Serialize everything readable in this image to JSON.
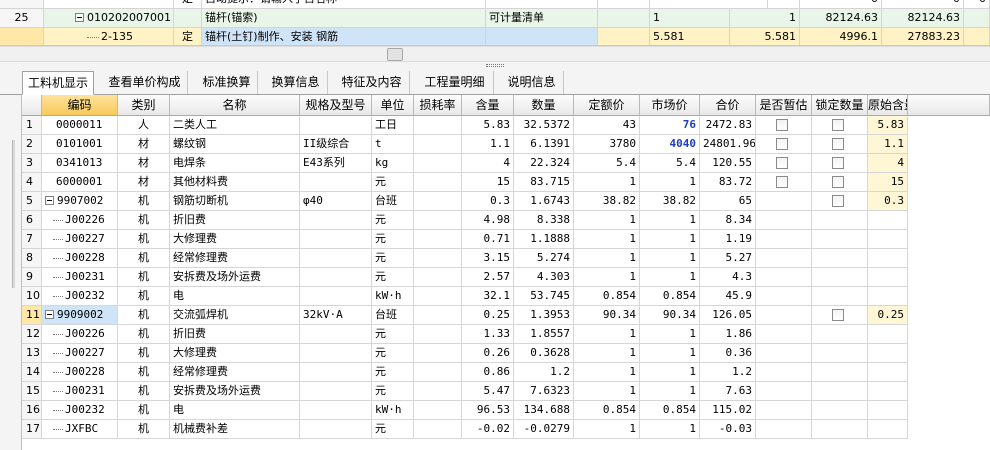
{
  "top_grid": {
    "rows": [
      {
        "num": "",
        "code": "",
        "type": "定",
        "name": "自动提示：请输入子目名称",
        "unit": "",
        "expr": "",
        "qty": "",
        "col8": "0",
        "col9": "0",
        "col10": "0"
      },
      {
        "num": "25",
        "code": "010202007001",
        "type": "",
        "name": "锚杆(锚索)",
        "unit": "可计量清单",
        "expr": "1",
        "qty": "1",
        "col8": "82124.63",
        "col9": "82124.63",
        "col10": ""
      },
      {
        "num": "",
        "code": "2-135",
        "type": "定",
        "name": "锚杆(土钉)制作、安装 钢筋",
        "unit": "",
        "expr": "5.581",
        "qty": "5.581",
        "col8": "4996.1",
        "col9": "27883.23",
        "col10": ""
      }
    ]
  },
  "tabs": [
    {
      "label": "工料机显示",
      "active": true
    },
    {
      "label": "查看单价构成",
      "active": false
    },
    {
      "label": "标准换算",
      "active": false
    },
    {
      "label": "换算信息",
      "active": false
    },
    {
      "label": "特征及内容",
      "active": false
    },
    {
      "label": "工程量明细",
      "active": false
    },
    {
      "label": "说明信息",
      "active": false
    }
  ],
  "main_grid": {
    "headers": [
      "编码",
      "类别",
      "名称",
      "规格及型号",
      "单位",
      "损耗率",
      "含量",
      "数量",
      "定额价",
      "市场价",
      "合价",
      "是否暂估",
      "锁定数量",
      "原始含量"
    ],
    "rows": [
      {
        "n": "1",
        "code": "0000011",
        "cat": "人",
        "name": "二类人工",
        "spec": "",
        "unit": "工日",
        "loss": "",
        "content": "5.83",
        "qty": "32.5372",
        "quota": "43",
        "market": "76",
        "total": "2472.83",
        "est": false,
        "lock": true,
        "orig": "5.83",
        "market_hi": true,
        "child": false,
        "group": false
      },
      {
        "n": "2",
        "code": "0101001",
        "cat": "材",
        "name": "螺纹钢",
        "spec": "II级综合",
        "unit": "t",
        "loss": "",
        "content": "1.1",
        "qty": "6.1391",
        "quota": "3780",
        "market": "4040",
        "total": "24801.96",
        "est": true,
        "lock": true,
        "orig": "1.1",
        "market_hi": true,
        "child": false,
        "group": false
      },
      {
        "n": "3",
        "code": "0341013",
        "cat": "材",
        "name": "电焊条",
        "spec": "E43系列",
        "unit": "kg",
        "loss": "",
        "content": "4",
        "qty": "22.324",
        "quota": "5.4",
        "market": "5.4",
        "total": "120.55",
        "est": true,
        "lock": true,
        "orig": "4",
        "market_hi": false,
        "child": false,
        "group": false
      },
      {
        "n": "4",
        "code": "6000001",
        "cat": "材",
        "name": "其他材料费",
        "spec": "",
        "unit": "元",
        "loss": "",
        "content": "15",
        "qty": "83.715",
        "quota": "1",
        "market": "1",
        "total": "83.72",
        "est": false,
        "lock": true,
        "orig": "15",
        "market_hi": false,
        "child": false,
        "group": false
      },
      {
        "n": "5",
        "code": "9907002",
        "cat": "机",
        "name": "钢筋切断机",
        "spec": "φ40",
        "unit": "台班",
        "loss": "",
        "content": "0.3",
        "qty": "1.6743",
        "quota": "38.82",
        "market": "38.82",
        "total": "65",
        "est": null,
        "lock": true,
        "orig": "0.3",
        "market_hi": false,
        "child": false,
        "group": true
      },
      {
        "n": "6",
        "code": "J00226",
        "cat": "机",
        "name": "折旧费",
        "spec": "",
        "unit": "元",
        "loss": "",
        "content": "4.98",
        "qty": "8.338",
        "quota": "1",
        "market": "1",
        "total": "8.34",
        "est": null,
        "lock": null,
        "orig": "",
        "market_hi": false,
        "child": true,
        "group": false
      },
      {
        "n": "7",
        "code": "J00227",
        "cat": "机",
        "name": "大修理费",
        "spec": "",
        "unit": "元",
        "loss": "",
        "content": "0.71",
        "qty": "1.1888",
        "quota": "1",
        "market": "1",
        "total": "1.19",
        "est": null,
        "lock": null,
        "orig": "",
        "market_hi": false,
        "child": true,
        "group": false
      },
      {
        "n": "8",
        "code": "J00228",
        "cat": "机",
        "name": "经常修理费",
        "spec": "",
        "unit": "元",
        "loss": "",
        "content": "3.15",
        "qty": "5.274",
        "quota": "1",
        "market": "1",
        "total": "5.27",
        "est": null,
        "lock": null,
        "orig": "",
        "market_hi": false,
        "child": true,
        "group": false
      },
      {
        "n": "9",
        "code": "J00231",
        "cat": "机",
        "name": "安拆费及场外运费",
        "spec": "",
        "unit": "元",
        "loss": "",
        "content": "2.57",
        "qty": "4.303",
        "quota": "1",
        "market": "1",
        "total": "4.3",
        "est": null,
        "lock": null,
        "orig": "",
        "market_hi": false,
        "child": true,
        "group": false
      },
      {
        "n": "10",
        "code": "J00232",
        "cat": "机",
        "name": "电",
        "spec": "",
        "unit": "kW·h",
        "loss": "",
        "content": "32.1",
        "qty": "53.745",
        "quota": "0.854",
        "market": "0.854",
        "total": "45.9",
        "est": null,
        "lock": null,
        "orig": "",
        "market_hi": false,
        "child": true,
        "group": false
      },
      {
        "n": "11",
        "code": "9909002",
        "cat": "机",
        "name": "交流弧焊机",
        "spec": "32kV·A",
        "unit": "台班",
        "loss": "",
        "content": "0.25",
        "qty": "1.3953",
        "quota": "90.34",
        "market": "90.34",
        "total": "126.05",
        "est": null,
        "lock": true,
        "orig": "0.25",
        "market_hi": false,
        "child": false,
        "group": true
      },
      {
        "n": "12",
        "code": "J00226",
        "cat": "机",
        "name": "折旧费",
        "spec": "",
        "unit": "元",
        "loss": "",
        "content": "1.33",
        "qty": "1.8557",
        "quota": "1",
        "market": "1",
        "total": "1.86",
        "est": null,
        "lock": null,
        "orig": "",
        "market_hi": false,
        "child": true,
        "group": false
      },
      {
        "n": "13",
        "code": "J00227",
        "cat": "机",
        "name": "大修理费",
        "spec": "",
        "unit": "元",
        "loss": "",
        "content": "0.26",
        "qty": "0.3628",
        "quota": "1",
        "market": "1",
        "total": "0.36",
        "est": null,
        "lock": null,
        "orig": "",
        "market_hi": false,
        "child": true,
        "group": false
      },
      {
        "n": "14",
        "code": "J00228",
        "cat": "机",
        "name": "经常修理费",
        "spec": "",
        "unit": "元",
        "loss": "",
        "content": "0.86",
        "qty": "1.2",
        "quota": "1",
        "market": "1",
        "total": "1.2",
        "est": null,
        "lock": null,
        "orig": "",
        "market_hi": false,
        "child": true,
        "group": false
      },
      {
        "n": "15",
        "code": "J00231",
        "cat": "机",
        "name": "安拆费及场外运费",
        "spec": "",
        "unit": "元",
        "loss": "",
        "content": "5.47",
        "qty": "7.6323",
        "quota": "1",
        "market": "1",
        "total": "7.63",
        "est": null,
        "lock": null,
        "orig": "",
        "market_hi": false,
        "child": true,
        "group": false
      },
      {
        "n": "16",
        "code": "J00232",
        "cat": "机",
        "name": "电",
        "spec": "",
        "unit": "kW·h",
        "loss": "",
        "content": "96.53",
        "qty": "134.688",
        "quota": "0.854",
        "market": "0.854",
        "total": "115.02",
        "est": null,
        "lock": null,
        "orig": "",
        "market_hi": false,
        "child": true,
        "group": false
      },
      {
        "n": "17",
        "code": "JXFBC",
        "cat": "机",
        "name": "机械费补差",
        "spec": "",
        "unit": "元",
        "loss": "",
        "content": "-0.02",
        "qty": "-0.0279",
        "quota": "1",
        "market": "1",
        "total": "-0.03",
        "est": null,
        "lock": null,
        "orig": "",
        "market_hi": false,
        "child": true,
        "group": false
      }
    ]
  },
  "colors": {
    "selected_header": "#f7c95a",
    "highlight_row": "#e9f5e9",
    "blue_value": "#1f3fb9",
    "current_row": "#fff2c4"
  }
}
